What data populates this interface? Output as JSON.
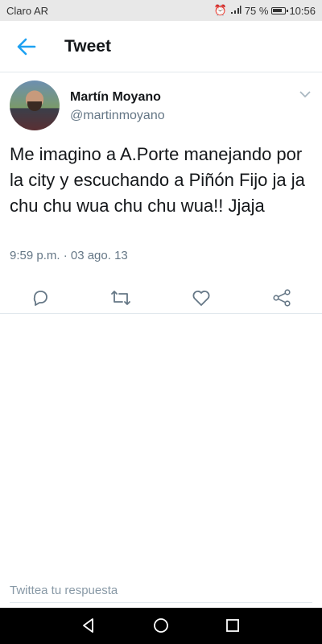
{
  "status_bar": {
    "carrier": "Claro AR",
    "battery": "75 %",
    "time": "10:56"
  },
  "header": {
    "title": "Tweet",
    "back_icon": "arrow-left-icon"
  },
  "tweet": {
    "author_name": "Martín Moyano",
    "author_handle": "@martinmoyano",
    "text": "Me imagino a A.Porte manejando por la city y escuchando a Piñón Fijo ja ja chu chu wua chu chu wua!! Jjaja",
    "timestamp": "9:59 p.m. · 03 ago. 13"
  },
  "actions": {
    "icons": [
      "reply-icon",
      "retweet-icon",
      "like-icon",
      "share-icon"
    ]
  },
  "reply": {
    "placeholder": "Twittea tu respuesta"
  },
  "colors": {
    "accent": "#1da1f2",
    "text": "#14171a",
    "secondary": "#657786"
  }
}
